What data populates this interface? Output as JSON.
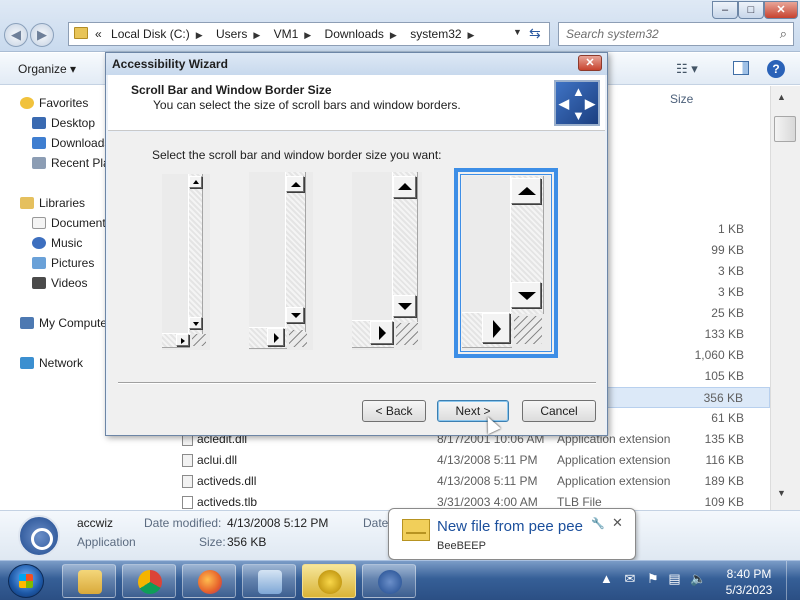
{
  "explorer": {
    "address": {
      "prefix": "«",
      "crumbs": [
        "Local Disk (C:)",
        "Users",
        "VM1",
        "Downloads",
        "system32"
      ]
    },
    "search_placeholder": "Search system32",
    "toolbar": {
      "organize": "Organize ▾"
    },
    "column_size": "Size",
    "nav": {
      "favorites": "Favorites",
      "desktop": "Desktop",
      "downloads": "Downloads",
      "recent": "Recent Places",
      "libraries": "Libraries",
      "documents": "Documents",
      "music": "Music",
      "pictures": "Pictures",
      "videos": "Videos",
      "mycomputer": "My Computer",
      "network": "Network"
    },
    "hidden_rows": [
      {
        "type": "rmation",
        "size": "1 KB"
      },
      {
        "type": "extension",
        "size": "99 KB"
      },
      {
        "type": "",
        "size": "3 KB"
      },
      {
        "type": "",
        "size": "3 KB"
      },
      {
        "type": "extension",
        "size": "25 KB"
      },
      {
        "type": "extension",
        "size": "133 KB"
      },
      {
        "type": "el item",
        "size": "1,060 KB"
      },
      {
        "type": "extension",
        "size": "105 KB"
      },
      {
        "type": "",
        "size": "356 KB"
      },
      {
        "type": "",
        "size": "61 KB"
      }
    ],
    "files": [
      {
        "name": "acledit.dll",
        "date": "8/17/2001 10:06 AM",
        "type": "Application extension",
        "size": "135 KB"
      },
      {
        "name": "aclui.dll",
        "date": "4/13/2008 5:11 PM",
        "type": "Application extension",
        "size": "116 KB"
      },
      {
        "name": "activeds.dll",
        "date": "4/13/2008 5:11 PM",
        "type": "Application extension",
        "size": "189 KB"
      },
      {
        "name": "activeds.tlb",
        "date": "3/31/2003 4:00 AM",
        "type": "TLB File",
        "size": "109 KB"
      }
    ],
    "details": {
      "name": "accwiz",
      "kind": "Application",
      "modified_label": "Date modified:",
      "modified_value": "4/13/2008 5:12 PM",
      "size_label": "Size:",
      "size_value": "356 KB",
      "date_label": "Date"
    }
  },
  "dialog": {
    "title": "Accessibility Wizard",
    "close": "✕",
    "heading": "Scroll Bar and Window Border Size",
    "subheading": "You can select the size of scroll bars and window borders.",
    "prompt": "Select the scroll bar and window border size you want:",
    "selected_option": 4,
    "buttons": {
      "back": "< Back",
      "next": "Next >",
      "cancel": "Cancel"
    }
  },
  "notification": {
    "title": "New file from pee pee",
    "subtitle": "BeeBEEP",
    "close": "✕"
  },
  "taskbar": {
    "time": "8:40 PM",
    "date": "5/3/2023",
    "apps": [
      "explorer",
      "chrome",
      "firefox",
      "control-panel",
      "beebeep",
      "accessibility-wizard"
    ]
  }
}
